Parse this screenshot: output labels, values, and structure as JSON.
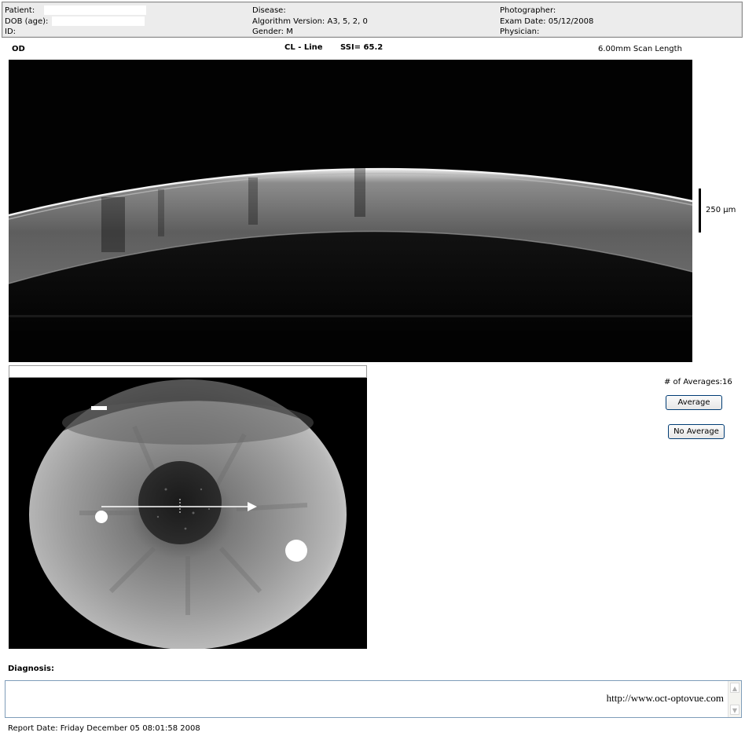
{
  "header": {
    "col1": {
      "patient_label": "Patient:",
      "dob_label": "DOB (age):",
      "id_label": "ID:"
    },
    "col2": {
      "disease_label": "Disease:",
      "algorithm": "Algorithm Version: A3, 5, 2, 0",
      "gender": "Gender: M"
    },
    "col3": {
      "photographer_label": "Photographer:",
      "exam_date": "Exam Date: 05/12/2008",
      "physician_label": "Physician:"
    }
  },
  "scan_info": {
    "eye": "OD",
    "scan_type": "CL - Line",
    "ssi": "SSI= 65.2",
    "scan_length": "6.00mm Scan Length",
    "scale_label": "250 µm"
  },
  "averaging": {
    "count_label": "# of Averages:16",
    "average_button": "Average",
    "no_average_button": "No Average"
  },
  "diagnosis": {
    "label": "Diagnosis:",
    "text": "http://www.oct-optovue.com"
  },
  "footer": {
    "report_date": "Report Date: Friday December 05 08:01:58 2008"
  },
  "icons": {
    "scroll_up": "scroll-up-icon",
    "scroll_down": "scroll-down-icon"
  }
}
